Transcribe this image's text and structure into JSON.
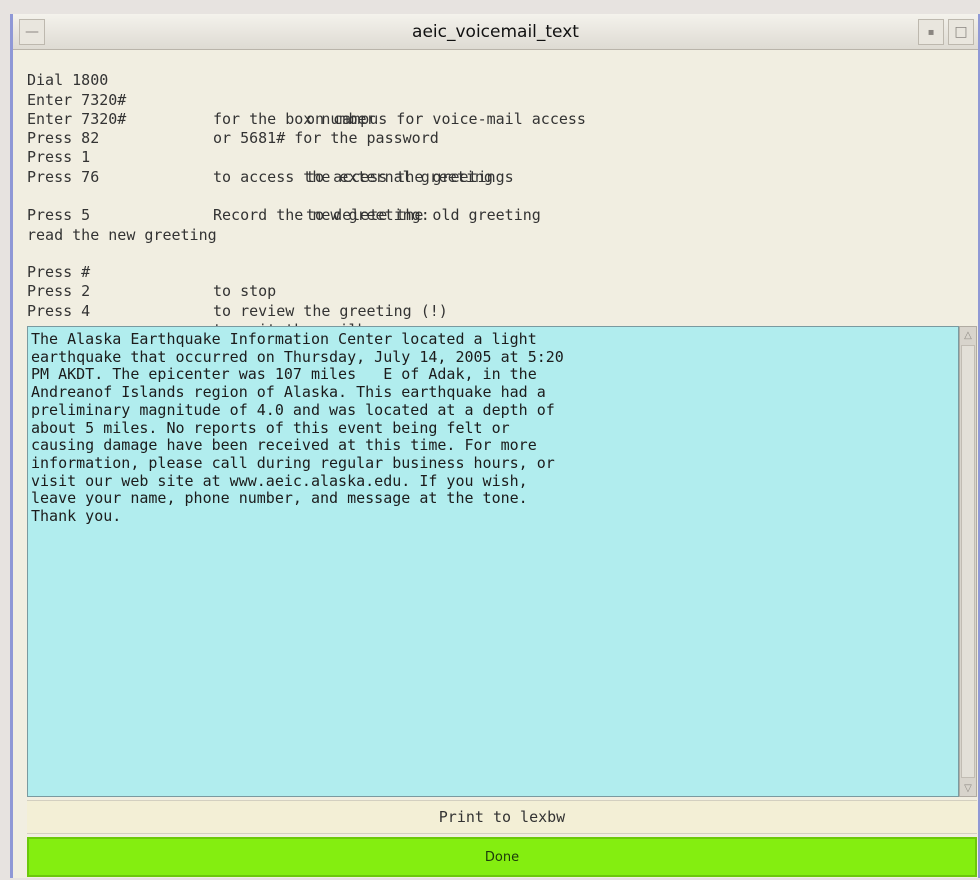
{
  "window": {
    "title": "aeic_voicemail_text",
    "icons": {
      "menu": "minus-icon",
      "minimize": "minimize-icon",
      "maximize": "maximize-icon"
    }
  },
  "instructions": [
    {
      "key": "Dial 1800",
      "action": "",
      "extra": "on campus for voice-mail access"
    },
    {
      "key": "Enter 7320#",
      "action": "for the box number",
      "extra": ""
    },
    {
      "key": "Enter 7320#",
      "action": "or 5681# for the password",
      "extra": ""
    },
    {
      "key": "Press 82",
      "action": "",
      "extra": "to access the greetings"
    },
    {
      "key": "Press 1",
      "action": "to access the external greeting",
      "extra": ""
    },
    {
      "key": "Press 76",
      "action": "",
      "extra": "to delete the old greeting"
    },
    {
      "key": "",
      "action": "Record the new greeting:",
      "extra": ""
    },
    {
      "key": "Press 5",
      "action": "",
      "extra": ""
    },
    {
      "key": "read the new greeting",
      "action": "",
      "extra": ""
    }
  ],
  "instructions2": [
    {
      "key": "Press #",
      "action": "to stop"
    },
    {
      "key": "Press 2",
      "action": "to review the greeting (!)"
    },
    {
      "key": "Press 4",
      "action": "to exit the mailbox"
    }
  ],
  "message": "The Alaska Earthquake Information Center located a light\nearthquake that occurred on Thursday, July 14, 2005 at 5:20\nPM AKDT. The epicenter was 107 miles   E of Adak, in the\nAndreanof Islands region of Alaska. This earthquake had a\npreliminary magnitude of 4.0 and was located at a depth of\nabout 5 miles. No reports of this event being felt or\ncausing damage have been received at this time. For more\ninformation, please call during regular business hours, or\nvisit our web site at www.aeic.alaska.edu. If you wish,\nleave your name, phone number, and message at the tone.\nThank you.",
  "buttons": {
    "print": "Print to lexbw",
    "done": "Done"
  },
  "scrollbar": {
    "up_icon": "up-arrow-icon",
    "down_icon": "down-arrow-icon"
  },
  "colors": {
    "message_bg": "#b1edee",
    "done_bg": "#84ee10",
    "window_bg": "#f1eee1",
    "frame": "#8f98d6"
  }
}
